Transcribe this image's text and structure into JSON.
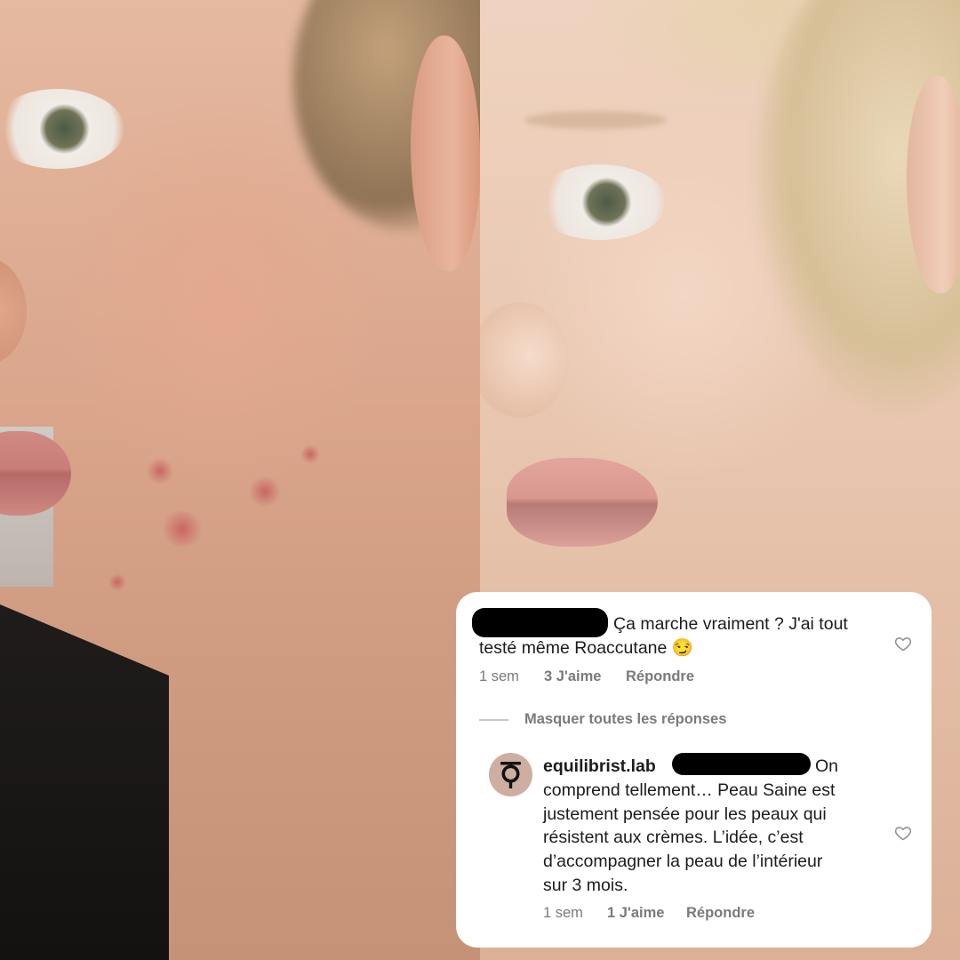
{
  "comment": {
    "text_line1": "Ça marche vraiment ? J'ai tout",
    "text_line2": "testé même Roaccutane 😏",
    "time": "1 sem",
    "likes": "3 J'aime",
    "reply_label": "Répondre"
  },
  "replies_toggle": "Masquer toutes les réponses",
  "reply": {
    "username": "equilibrist.lab",
    "text_first": "On",
    "lines": [
      "comprend tellement… Peau Saine est",
      "justement pensée pour les peaux qui",
      "résistent aux crèmes. L’idée, c’est",
      "d’accompagner la peau de l’intérieur",
      "sur 3 mois."
    ],
    "time": "1 sem",
    "likes": "1 J'aime",
    "reply_label": "Répondre"
  }
}
